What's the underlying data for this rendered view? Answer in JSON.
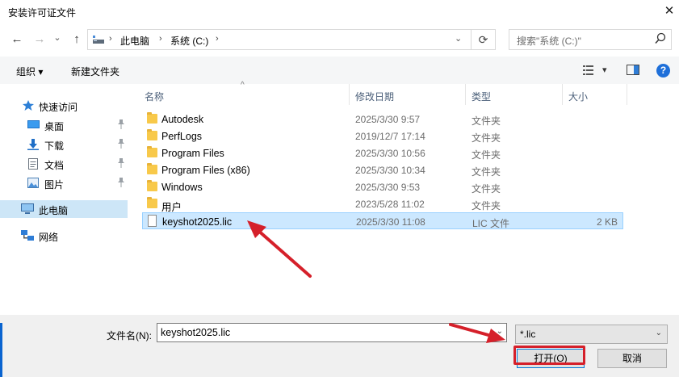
{
  "window": {
    "title": "安装许可证文件",
    "close_glyph": "✕"
  },
  "nav": {
    "back": "←",
    "forward": "→",
    "dropdown": "⌄",
    "up": "↑",
    "breadcrumb": [
      "此电脑",
      "系统 (C:)"
    ],
    "sep": "›",
    "refresh": "⟳",
    "search_placeholder": "搜索\"系统 (C:)\"",
    "search_icon": "search-icon"
  },
  "toolbar": {
    "organize": "组织 ▾",
    "new_folder": "新建文件夹",
    "view_dd": "▾"
  },
  "sidebar": {
    "items": [
      {
        "label": "快速访问",
        "icon": "star-icon",
        "pinned": false
      },
      {
        "label": "桌面",
        "icon": "desktop-icon",
        "pinned": true
      },
      {
        "label": "下载",
        "icon": "download-icon",
        "pinned": true
      },
      {
        "label": "文档",
        "icon": "document-icon",
        "pinned": true
      },
      {
        "label": "图片",
        "icon": "picture-icon",
        "pinned": true
      },
      {
        "label": "此电脑",
        "icon": "computer-icon",
        "pinned": false,
        "selected": true
      },
      {
        "label": "网络",
        "icon": "network-icon",
        "pinned": false
      }
    ],
    "pin_glyph": "📌"
  },
  "list": {
    "sort_glyph": "^",
    "headers": {
      "name": "名称",
      "date": "修改日期",
      "type": "类型",
      "size": "大小"
    },
    "rows": [
      {
        "name": "Autodesk",
        "date": "2025/3/30 9:57",
        "type": "文件夹",
        "size": ""
      },
      {
        "name": "PerfLogs",
        "date": "2019/12/7 17:14",
        "type": "文件夹",
        "size": ""
      },
      {
        "name": "Program Files",
        "date": "2025/3/30 10:56",
        "type": "文件夹",
        "size": ""
      },
      {
        "name": "Program Files (x86)",
        "date": "2025/3/30 10:34",
        "type": "文件夹",
        "size": ""
      },
      {
        "name": "Windows",
        "date": "2025/3/30 9:53",
        "type": "文件夹",
        "size": ""
      },
      {
        "name": "用户",
        "date": "2023/5/28 11:02",
        "type": "文件夹",
        "size": ""
      },
      {
        "name": "keyshot2025.lic",
        "date": "2025/3/30 11:08",
        "type": "LIC 文件",
        "size": "2 KB",
        "selected": true
      }
    ]
  },
  "bottom": {
    "filename_label": "文件名(N):",
    "filename_value": "keyshot2025.lic",
    "filetype_value": "*.lic",
    "dropdown_glyph": "⌄",
    "open_label": "打开(O)",
    "cancel_label": "取消"
  },
  "colors": {
    "accent": "#0078d7",
    "selection": "#cce8ff",
    "annotation": "#d5202a"
  }
}
